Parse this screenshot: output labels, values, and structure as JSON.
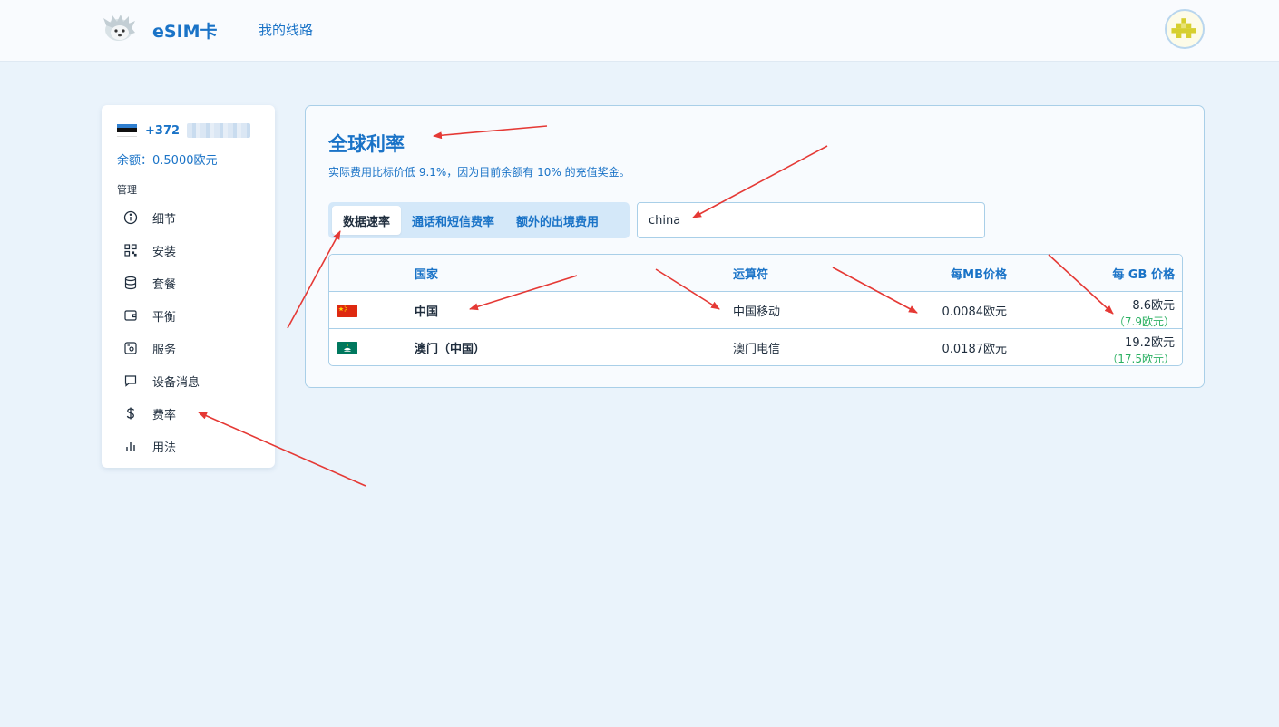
{
  "header": {
    "brand": "eSIM卡",
    "nav_link": "我的线路",
    "logo_icon": "hedgehog-logo-icon",
    "avatar_icon": "identicon-avatar"
  },
  "sidebar": {
    "phone_prefix": "+372",
    "balance": "余额：0.5000欧元",
    "section_label": "管理",
    "items": [
      {
        "label": "细节",
        "icon": "info-icon"
      },
      {
        "label": "安装",
        "icon": "qr-code-icon"
      },
      {
        "label": "套餐",
        "icon": "database-icon"
      },
      {
        "label": "平衡",
        "icon": "wallet-icon"
      },
      {
        "label": "服务",
        "icon": "service-icon"
      },
      {
        "label": "设备消息",
        "icon": "message-icon"
      },
      {
        "label": "费率",
        "icon": "dollar-icon"
      },
      {
        "label": "用法",
        "icon": "bar-chart-icon"
      }
    ]
  },
  "main": {
    "title": "全球利率",
    "subtitle": "实际费用比标价低 9.1%，因为目前余额有 10% 的充值奖金。",
    "tabs": [
      {
        "label": "数据速率",
        "active": true
      },
      {
        "label": "通话和短信费率",
        "active": false
      },
      {
        "label": "额外的出境费用",
        "active": false
      }
    ],
    "search_value": "china",
    "table": {
      "headers": {
        "country": "国家",
        "operator": "运算符",
        "per_mb": "每MB价格",
        "per_gb": "每 GB 价格"
      },
      "rows": [
        {
          "flag": "china-flag-icon",
          "country": "中国",
          "operator": "中国移动",
          "per_mb": "0.0084欧元",
          "per_gb": "8.6欧元",
          "per_gb_discount": "（7.9欧元）"
        },
        {
          "flag": "macau-flag-icon",
          "country": "澳门（中国）",
          "operator": "澳门电信",
          "per_mb": "0.0187欧元",
          "per_gb": "19.2欧元",
          "per_gb_discount": "（17.5欧元）"
        }
      ]
    }
  },
  "colors": {
    "accent": "#1a73c7",
    "background": "#eaf3fb",
    "border": "#a9cfe8",
    "discount": "#2bb062",
    "annotation": "#e53935"
  }
}
